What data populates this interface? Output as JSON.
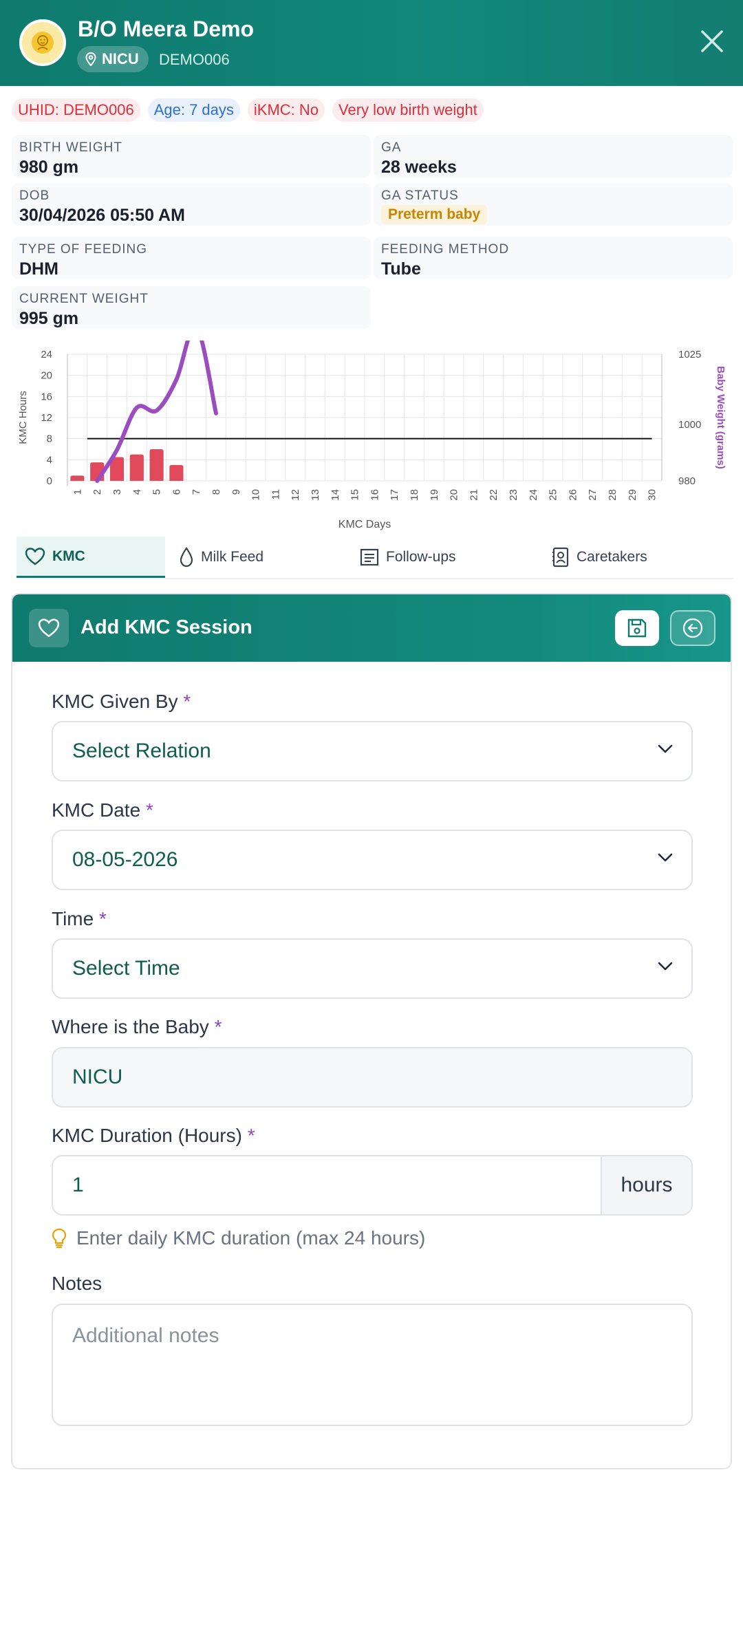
{
  "header": {
    "title": "B/O Meera Demo",
    "location": "NICU",
    "patient_id": "DEMO006"
  },
  "chips": [
    {
      "text": "UHID: DEMO006",
      "tone": "red"
    },
    {
      "text": "Age: 7 days",
      "tone": "blue"
    },
    {
      "text": "iKMC: No",
      "tone": "red"
    },
    {
      "text": "Very low birth weight",
      "tone": "red"
    }
  ],
  "info": {
    "birth_weight": {
      "label": "BIRTH WEIGHT",
      "value": "980 gm"
    },
    "ga": {
      "label": "GA",
      "value": "28 weeks"
    },
    "dob": {
      "label": "DOB",
      "value": "30/04/2026 05:50 AM"
    },
    "ga_status": {
      "label": "GA STATUS",
      "value": "Preterm baby"
    },
    "feeding_type": {
      "label": "TYPE OF FEEDING",
      "value": "DHM"
    },
    "feeding_method": {
      "label": "FEEDING METHOD",
      "value": "Tube"
    },
    "current_weight": {
      "label": "CURRENT WEIGHT",
      "value": "995 gm"
    }
  },
  "chart_data": {
    "type": "bar",
    "categories": [
      "1",
      "2",
      "3",
      "4",
      "5",
      "6",
      "7",
      "8",
      "9",
      "10",
      "11",
      "12",
      "13",
      "14",
      "15",
      "16",
      "17",
      "18",
      "19",
      "20",
      "21",
      "22",
      "23",
      "24",
      "25",
      "26",
      "27",
      "28",
      "29",
      "30"
    ],
    "xlabel": "KMC Days",
    "ylabel": "KMC Hours",
    "y2label": "Baby Weight (grams)",
    "ylim": [
      0,
      24
    ],
    "yticks": [
      "0",
      "4",
      "8",
      "12",
      "16",
      "20",
      "24"
    ],
    "y2lim": [
      980,
      1025
    ],
    "y2ticks": [
      "980",
      "1000",
      "1025"
    ],
    "grid": true,
    "series": [
      {
        "kind": "bar",
        "axis": "left",
        "color": "#e04a5a",
        "values": [
          1,
          3.5,
          4.5,
          5,
          6,
          3,
          null,
          null,
          null,
          null,
          null,
          null,
          null,
          null,
          null,
          null,
          null,
          null,
          null,
          null,
          null,
          null,
          null,
          null,
          null,
          null,
          null,
          null,
          null,
          null
        ]
      },
      {
        "kind": "line",
        "axis": "right",
        "color": "#9b4dbf",
        "values": [
          null,
          980,
          991,
          1006,
          1005,
          1016,
          1035,
          1004,
          null,
          null,
          null,
          null,
          null,
          null,
          null,
          null,
          null,
          null,
          null,
          null,
          null,
          null,
          null,
          null,
          null,
          null,
          null,
          null,
          null,
          null
        ]
      },
      {
        "kind": "reference",
        "axis": "left",
        "color": "#111111",
        "value": 8,
        "from": 1.5,
        "to": 30
      }
    ]
  },
  "tabs": [
    {
      "label": "KMC",
      "icon": "heart-icon",
      "active": true
    },
    {
      "label": "Milk Feed",
      "icon": "drop-icon",
      "active": false
    },
    {
      "label": "Follow-ups",
      "icon": "document-icon",
      "active": false
    },
    {
      "label": "Caretakers",
      "icon": "contact-icon",
      "active": false
    }
  ],
  "form": {
    "title": "Add KMC Session",
    "required_mark": "*",
    "given_by": {
      "label": "KMC Given By",
      "value": "Select Relation"
    },
    "date": {
      "label": "KMC Date",
      "value": "08-05-2026"
    },
    "time": {
      "label": "Time",
      "value": "Select Time"
    },
    "where": {
      "label": "Where is the Baby",
      "value": "NICU"
    },
    "duration": {
      "label": "KMC Duration (Hours)",
      "value": "1",
      "unit": "hours"
    },
    "hint": "Enter daily KMC duration (max 24 hours)",
    "notes": {
      "label": "Notes",
      "placeholder": "Additional notes"
    }
  },
  "colors": {
    "primary": "#0f7a6e",
    "bar": "#e04a5a",
    "weight_line": "#9b4dbf",
    "required": "#8b45c9"
  }
}
